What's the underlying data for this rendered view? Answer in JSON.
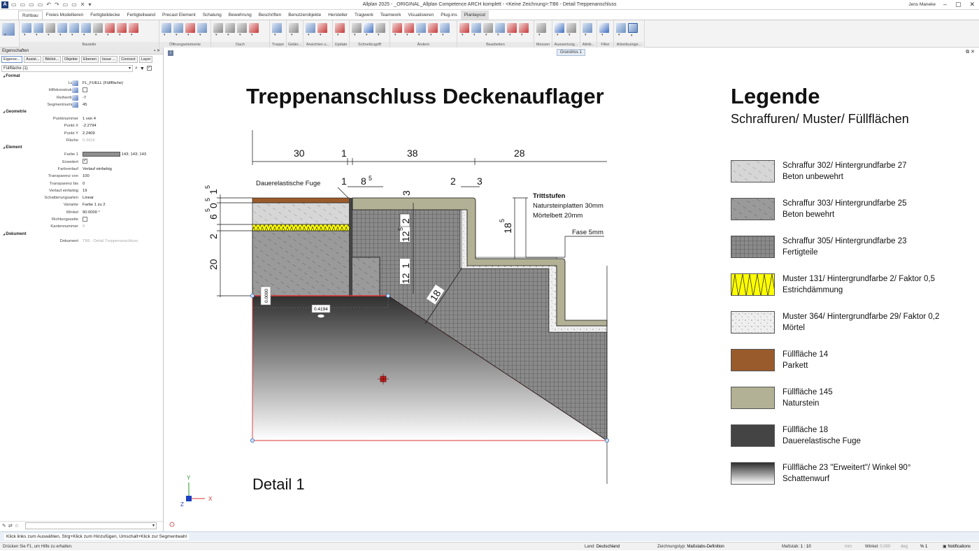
{
  "window": {
    "title": "Allplan 2025 - _ORIGINAL_Allplan Competence ARCH komplett - <Keine Zeichnung>:TB6 - Detail Treppenanschluss",
    "user": "Jens Maneke"
  },
  "ribbon": {
    "tabs": [
      "Rohbau",
      "Freies Modellieren",
      "Fertigteildecke",
      "Fertigteilwand",
      "Precast Element",
      "Schalung",
      "Bewehrung",
      "Beschriften",
      "Benutzerobjekte",
      "Hersteller",
      "Tragwerk",
      "Teamwork",
      "Visualisieren",
      "Plug-ins",
      "Planlayout"
    ],
    "active_tab": "Rohbau",
    "groups": [
      "Bauteile",
      "Öffnungselemente",
      "Dach",
      "Treppe",
      "Gelän...",
      "Ansichten u...",
      "Update",
      "Schnellzugriff",
      "Ändern",
      "Bearbeiten",
      "Messen",
      "Auswertung...",
      "Attrib...",
      "Filter",
      "Arbeitsumge..."
    ]
  },
  "panel": {
    "title": "Eigenschaften",
    "tabs": [
      "Eigensc...",
      "Assist...",
      "Bibliot...",
      "Objekte",
      "Ebenen",
      "Issue ...",
      "Connect",
      "Layer"
    ],
    "selection": "Füllfläche (1)",
    "sections": {
      "format": "Format",
      "geometrie": "Geometrie",
      "element": "Element",
      "dokument": "Dokument"
    },
    "props": {
      "layer_k": "Layer",
      "layer_v": "FL_FUELL (Füllfläche)",
      "hilf_k": "Hilfskonstruktion",
      "reihen_k": "Reihenfolge",
      "reihen_v": "-7",
      "segnum_k": "Segmentnummer",
      "segnum_v": "45",
      "punktnr_k": "Punktnummer",
      "punktnr_v": "1 von 4",
      "px_k": "Punkt X",
      "px_v": "-2.2794",
      "py_k": "Punkt Y",
      "py_v": "2.2409",
      "flaeche_k": "Fläche",
      "flaeche_v": "0.3416",
      "farbe_k": "Farbe 1",
      "farbe_v": "143; 143; 143",
      "erw_k": "Erweitert",
      "farbverlauf_k": "Farbverlauf",
      "farbverlauf_v": "Verlauf einfarbig",
      "tvon_k": "Transparenz von",
      "tvon_v": "100",
      "tbis_k": "Transparenz bis",
      "tbis_v": "0",
      "vein_k": "Verlauf einfarbig",
      "vein_v": "19",
      "schatt_k": "Schattierungsarten",
      "schatt_v": "Linear",
      "var_k": "Variante",
      "var_v": "Farbe 1 zu 2",
      "winkel_k": "Winkel",
      "winkel_v": "90.0000 °",
      "richt_k": "Richtungsseite",
      "kanten_k": "Kantennummer",
      "kanten_v": "0",
      "dok_k": "Dokument",
      "dok_v": "TB6 - Detail Treppenanschluss"
    }
  },
  "viewport": {
    "view_label": "Grundriss 1",
    "title": "Treppenanschluss Deckenauflager",
    "detail_label": "Detail 1",
    "dims": {
      "d30": "30",
      "d1a": "1",
      "d38": "38",
      "d28": "28",
      "d1b": "1",
      "d8": "8",
      "d8e": "5",
      "d3a": "3",
      "d2a": "2",
      "d3b": "3",
      "d6": "6",
      "d6e": "5",
      "d0": "0",
      "d0e": "5",
      "d1c": "1",
      "d1ce": "5",
      "d2b": "2",
      "d20": "20",
      "d12a": "12",
      "d12ae": "5",
      "d2c": "2",
      "d12b": "12",
      "d1d": "1",
      "d18": "18",
      "d18b": "18",
      "d18be": "5",
      "fuge": "Dauerelastische Fuge",
      "tritt1": "Trittstufen",
      "tritt2": "Natursteinplatten 30mm",
      "tritt3": "Mörtelbett 20mm",
      "fase": "Fase 5mm",
      "sel_a": "0.0000",
      "sel_b": "0.4194",
      "ax_x": "X",
      "ax_y": "Y",
      "ax_z": "Z"
    },
    "legend": {
      "title": "Legende",
      "subtitle": "Schraffuren/ Muster/ Füllflächen",
      "items": [
        {
          "l1": "Schraffur 302/ Hintergrundfarbe 27",
          "l2": "Beton unbewehrt"
        },
        {
          "l1": "Schraffur 303/ Hintergrundfarbe 25",
          "l2": "Beton bewehrt"
        },
        {
          "l1": "Schraffur 305/ Hintergrundfarbe 23",
          "l2": "Fertigteile"
        },
        {
          "l1": "Muster 131/ Hintergrundfarbe 2/ Faktor 0,5",
          "l2": "Estrichdämmung"
        },
        {
          "l1": "Muster 364/ Hintergrundfarbe 29/ Faktor 0,2",
          "l2": "Mörtel"
        },
        {
          "l1": "Füllfläche 14",
          "l2": "Parkett"
        },
        {
          "l1": "Füllfläche 145",
          "l2": "Naturstein"
        },
        {
          "l1": "Füllfläche 18",
          "l2": "Dauerelastische Fuge"
        },
        {
          "l1": "Füllfläche 23 \"Erweitert\"/ Winkel 90°",
          "l2": "Schattenwurf"
        }
      ]
    }
  },
  "status": {
    "hint": "Klick links zum Auswählen, Strg+Klick zum Hinzufügen, Umschalt+Klick zur Segmentwahl",
    "help": "Drücken Sie F1, um Hilfe zu erhalten.",
    "land_k": "Land:",
    "land_v": "Deutschland",
    "ztyp_k": "Zeichnungstyp:",
    "ztyp_v": "Maßstabs-Definition",
    "mass_k": "Maßstab:",
    "mass_v": "1 : 10",
    "einh": "mm",
    "winkel_k": "Winkel:",
    "winkel_v": "0.000",
    "deg": "deg",
    "pct": "% 1",
    "notif": "Notifications"
  },
  "colors": {
    "beton_unbewehrt": "#d6d6d6",
    "beton_bewehrt": "#9a9a9a",
    "fertigteile": "#8a8a8a",
    "daemmung": "#ffff00",
    "moertel": "#efefef",
    "parkett": "#9a5b2c",
    "naturstein": "#b2b195",
    "fuge": "#444444",
    "accent": "#1f5fa8"
  }
}
